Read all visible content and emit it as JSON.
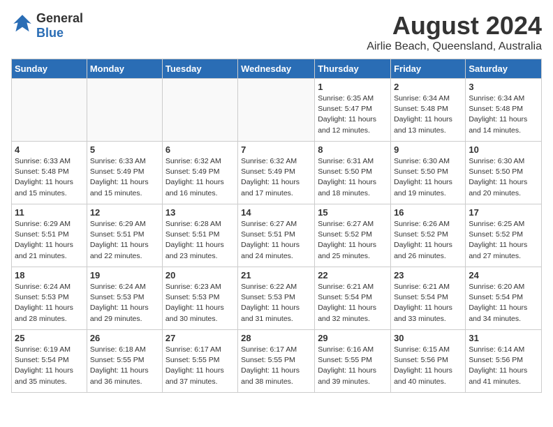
{
  "header": {
    "logo_general": "General",
    "logo_blue": "Blue",
    "title": "August 2024",
    "subtitle": "Airlie Beach, Queensland, Australia"
  },
  "days_of_week": [
    "Sunday",
    "Monday",
    "Tuesday",
    "Wednesday",
    "Thursday",
    "Friday",
    "Saturday"
  ],
  "weeks": [
    [
      {
        "day": "",
        "info": "",
        "empty": true
      },
      {
        "day": "",
        "info": "",
        "empty": true
      },
      {
        "day": "",
        "info": "",
        "empty": true
      },
      {
        "day": "",
        "info": "",
        "empty": true
      },
      {
        "day": "1",
        "info": "Sunrise: 6:35 AM\nSunset: 5:47 PM\nDaylight: 11 hours\nand 12 minutes.",
        "empty": false
      },
      {
        "day": "2",
        "info": "Sunrise: 6:34 AM\nSunset: 5:48 PM\nDaylight: 11 hours\nand 13 minutes.",
        "empty": false
      },
      {
        "day": "3",
        "info": "Sunrise: 6:34 AM\nSunset: 5:48 PM\nDaylight: 11 hours\nand 14 minutes.",
        "empty": false
      }
    ],
    [
      {
        "day": "4",
        "info": "Sunrise: 6:33 AM\nSunset: 5:48 PM\nDaylight: 11 hours\nand 15 minutes.",
        "empty": false
      },
      {
        "day": "5",
        "info": "Sunrise: 6:33 AM\nSunset: 5:49 PM\nDaylight: 11 hours\nand 15 minutes.",
        "empty": false
      },
      {
        "day": "6",
        "info": "Sunrise: 6:32 AM\nSunset: 5:49 PM\nDaylight: 11 hours\nand 16 minutes.",
        "empty": false
      },
      {
        "day": "7",
        "info": "Sunrise: 6:32 AM\nSunset: 5:49 PM\nDaylight: 11 hours\nand 17 minutes.",
        "empty": false
      },
      {
        "day": "8",
        "info": "Sunrise: 6:31 AM\nSunset: 5:50 PM\nDaylight: 11 hours\nand 18 minutes.",
        "empty": false
      },
      {
        "day": "9",
        "info": "Sunrise: 6:30 AM\nSunset: 5:50 PM\nDaylight: 11 hours\nand 19 minutes.",
        "empty": false
      },
      {
        "day": "10",
        "info": "Sunrise: 6:30 AM\nSunset: 5:50 PM\nDaylight: 11 hours\nand 20 minutes.",
        "empty": false
      }
    ],
    [
      {
        "day": "11",
        "info": "Sunrise: 6:29 AM\nSunset: 5:51 PM\nDaylight: 11 hours\nand 21 minutes.",
        "empty": false
      },
      {
        "day": "12",
        "info": "Sunrise: 6:29 AM\nSunset: 5:51 PM\nDaylight: 11 hours\nand 22 minutes.",
        "empty": false
      },
      {
        "day": "13",
        "info": "Sunrise: 6:28 AM\nSunset: 5:51 PM\nDaylight: 11 hours\nand 23 minutes.",
        "empty": false
      },
      {
        "day": "14",
        "info": "Sunrise: 6:27 AM\nSunset: 5:51 PM\nDaylight: 11 hours\nand 24 minutes.",
        "empty": false
      },
      {
        "day": "15",
        "info": "Sunrise: 6:27 AM\nSunset: 5:52 PM\nDaylight: 11 hours\nand 25 minutes.",
        "empty": false
      },
      {
        "day": "16",
        "info": "Sunrise: 6:26 AM\nSunset: 5:52 PM\nDaylight: 11 hours\nand 26 minutes.",
        "empty": false
      },
      {
        "day": "17",
        "info": "Sunrise: 6:25 AM\nSunset: 5:52 PM\nDaylight: 11 hours\nand 27 minutes.",
        "empty": false
      }
    ],
    [
      {
        "day": "18",
        "info": "Sunrise: 6:24 AM\nSunset: 5:53 PM\nDaylight: 11 hours\nand 28 minutes.",
        "empty": false
      },
      {
        "day": "19",
        "info": "Sunrise: 6:24 AM\nSunset: 5:53 PM\nDaylight: 11 hours\nand 29 minutes.",
        "empty": false
      },
      {
        "day": "20",
        "info": "Sunrise: 6:23 AM\nSunset: 5:53 PM\nDaylight: 11 hours\nand 30 minutes.",
        "empty": false
      },
      {
        "day": "21",
        "info": "Sunrise: 6:22 AM\nSunset: 5:53 PM\nDaylight: 11 hours\nand 31 minutes.",
        "empty": false
      },
      {
        "day": "22",
        "info": "Sunrise: 6:21 AM\nSunset: 5:54 PM\nDaylight: 11 hours\nand 32 minutes.",
        "empty": false
      },
      {
        "day": "23",
        "info": "Sunrise: 6:21 AM\nSunset: 5:54 PM\nDaylight: 11 hours\nand 33 minutes.",
        "empty": false
      },
      {
        "day": "24",
        "info": "Sunrise: 6:20 AM\nSunset: 5:54 PM\nDaylight: 11 hours\nand 34 minutes.",
        "empty": false
      }
    ],
    [
      {
        "day": "25",
        "info": "Sunrise: 6:19 AM\nSunset: 5:54 PM\nDaylight: 11 hours\nand 35 minutes.",
        "empty": false
      },
      {
        "day": "26",
        "info": "Sunrise: 6:18 AM\nSunset: 5:55 PM\nDaylight: 11 hours\nand 36 minutes.",
        "empty": false
      },
      {
        "day": "27",
        "info": "Sunrise: 6:17 AM\nSunset: 5:55 PM\nDaylight: 11 hours\nand 37 minutes.",
        "empty": false
      },
      {
        "day": "28",
        "info": "Sunrise: 6:17 AM\nSunset: 5:55 PM\nDaylight: 11 hours\nand 38 minutes.",
        "empty": false
      },
      {
        "day": "29",
        "info": "Sunrise: 6:16 AM\nSunset: 5:55 PM\nDaylight: 11 hours\nand 39 minutes.",
        "empty": false
      },
      {
        "day": "30",
        "info": "Sunrise: 6:15 AM\nSunset: 5:56 PM\nDaylight: 11 hours\nand 40 minutes.",
        "empty": false
      },
      {
        "day": "31",
        "info": "Sunrise: 6:14 AM\nSunset: 5:56 PM\nDaylight: 11 hours\nand 41 minutes.",
        "empty": false
      }
    ]
  ]
}
